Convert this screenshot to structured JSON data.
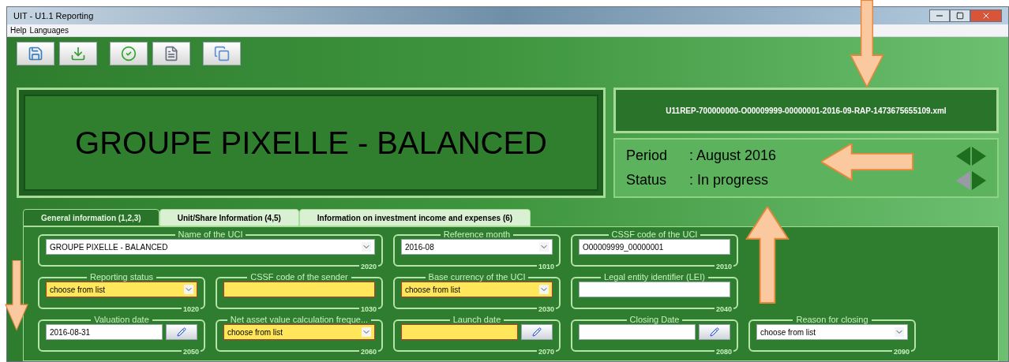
{
  "window": {
    "title": "UIT - U1.1 Reporting"
  },
  "menu": [
    "Help",
    "Languages"
  ],
  "fund_title": "GROUPE PIXELLE - BALANCED",
  "file_name": "U11REP-700000000-O00009999-00000001-2016-09-RAP-1473675655109.xml",
  "info_rows": [
    {
      "label": "Period",
      "value": ": August 2016",
      "prev_disabled": false
    },
    {
      "label": "Status",
      "value": ": In progress",
      "prev_disabled": true
    }
  ],
  "tabs": [
    {
      "label": "General information (1,2,3)",
      "selected": true
    },
    {
      "label": "Unit/Share Information (4,5)",
      "selected": false
    },
    {
      "label": "Information on investment income and expenses (6)",
      "selected": false
    }
  ],
  "form_rows": [
    [
      {
        "label": "Name of the UCI",
        "code": "2020",
        "kind": "dropdown",
        "value": "GROUPE PIXELLE - BALANCED",
        "required": false,
        "wide": true
      },
      {
        "label": "Reference month",
        "code": "1010",
        "kind": "dropdown",
        "value": "2016-08",
        "required": false,
        "wide": false
      },
      {
        "label": "CSSF code of the UCI",
        "code": "2010",
        "kind": "text",
        "value": "O00009999_00000001",
        "required": false,
        "wide": false
      }
    ],
    [
      {
        "label": "Reporting status",
        "code": "1020",
        "kind": "dropdown",
        "value": "choose from list",
        "required": true,
        "wide": false
      },
      {
        "label": "CSSF code of the sender",
        "code": "1030",
        "kind": "text",
        "required": true,
        "wide": false
      },
      {
        "label": "Base currency of the UCI",
        "code": "2030",
        "kind": "dropdown",
        "value": "choose from list",
        "required": true,
        "wide": false
      },
      {
        "label": "Legal entity identifier (LEI)",
        "code": "2040",
        "kind": "text",
        "required": false,
        "wide": false
      }
    ],
    [
      {
        "label": "Valuation date",
        "code": "2050",
        "kind": "date",
        "value": "2016-08-31",
        "required": false,
        "wide": false
      },
      {
        "label": "Net asset value calculation freque...",
        "code": "2060",
        "kind": "dropdown",
        "value": "choose from list",
        "required": true,
        "wide": false
      },
      {
        "label": "Launch date",
        "code": "2070",
        "kind": "date",
        "required": true,
        "wide": false
      },
      {
        "label": "Closing Date",
        "code": "2080",
        "kind": "date",
        "required": false,
        "wide": false
      },
      {
        "label": "Reason for closing",
        "code": "2090",
        "kind": "dropdown",
        "value": "choose from list",
        "required": false,
        "wide": false
      }
    ]
  ]
}
